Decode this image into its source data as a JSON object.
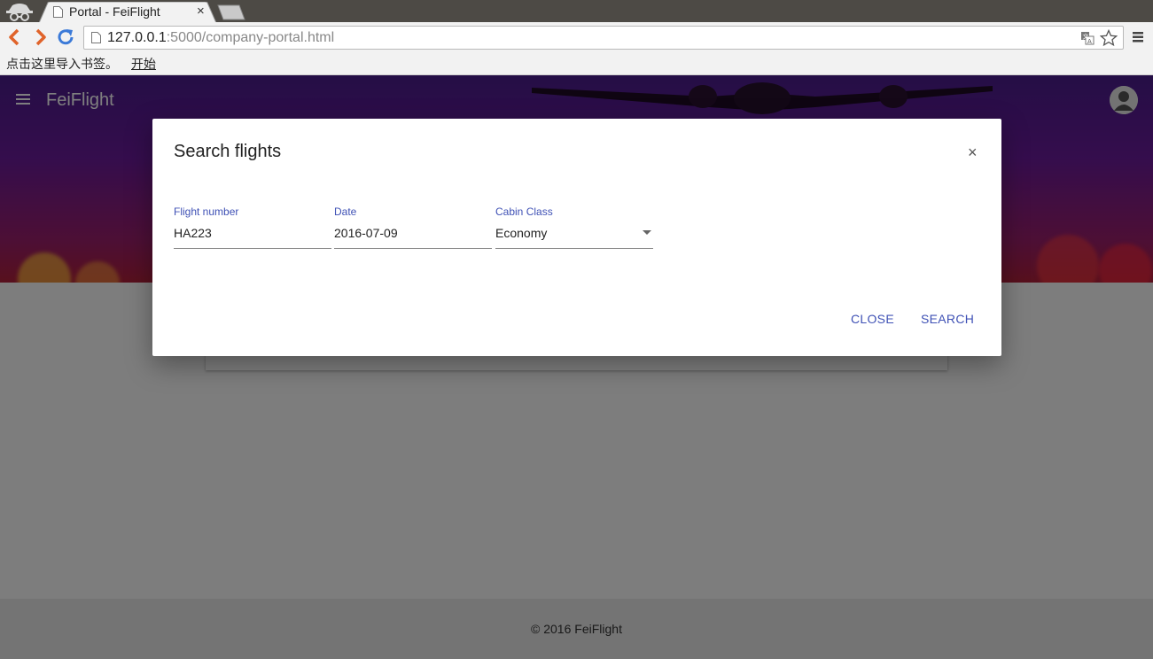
{
  "browser": {
    "tab_title": "Portal - FeiFlight",
    "tab_close": "×",
    "url_host": "127.0.0.1",
    "url_rest": ":5000/company-portal.html",
    "bookmarks_prompt": "点击这里导入书签。",
    "bookmarks_link": "开始"
  },
  "app": {
    "title": "FeiFlight",
    "footer": "© 2016 FeiFlight"
  },
  "dialog": {
    "title": "Search flights",
    "close_symbol": "×",
    "fields": {
      "flight_number": {
        "label": "Flight number",
        "value": "HA223"
      },
      "date": {
        "label": "Date",
        "value": "2016-07-09"
      },
      "cabin_class": {
        "label": "Cabin Class",
        "value": "Economy"
      }
    },
    "close_button": "CLOSE",
    "search_button": "SEARCH"
  },
  "colors": {
    "accent": "#3f51b5",
    "hero_top": "#4a1c8c",
    "hero_bottom": "#b0203a"
  }
}
